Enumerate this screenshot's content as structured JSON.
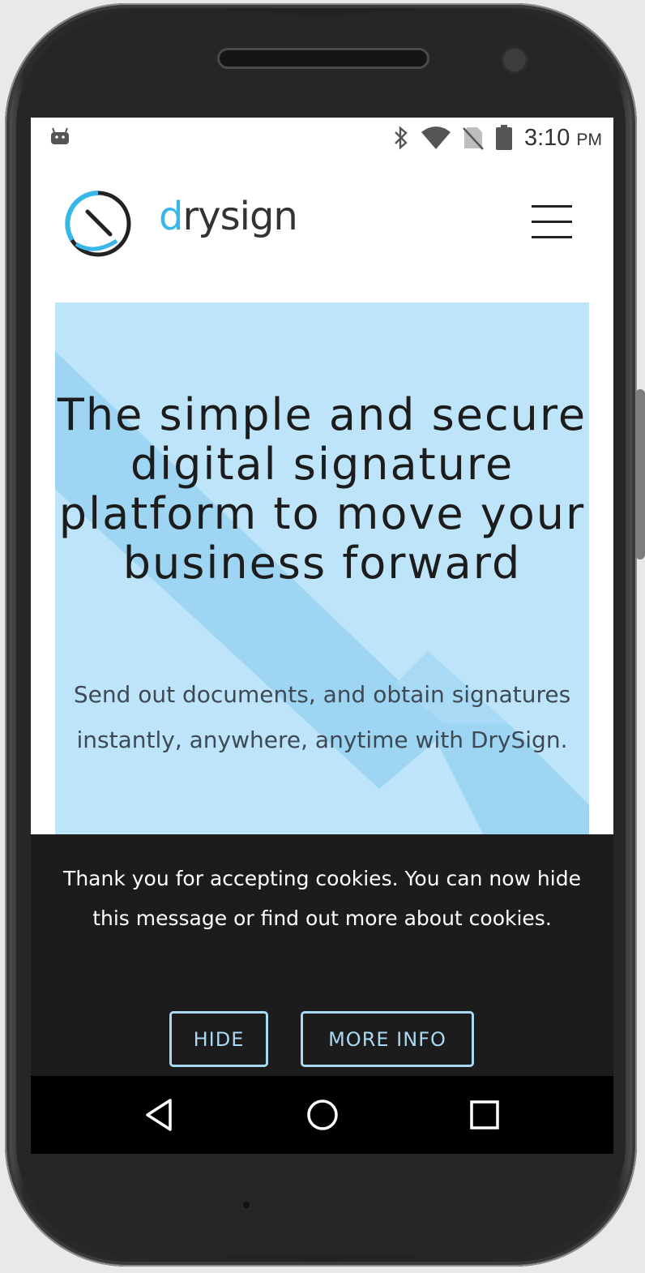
{
  "status_bar": {
    "time": "3:10",
    "ampm": "PM",
    "icons": [
      "android-debug-icon",
      "bluetooth-icon",
      "wifi-icon",
      "no-sim-icon",
      "battery-icon"
    ]
  },
  "header": {
    "logo_text_prefix": "d",
    "logo_text_rest": "rysign",
    "menu_icon": "hamburger-menu-icon"
  },
  "hero": {
    "title": "The simple and secure digital signature platform to move your business forward",
    "subtitle": "Send out documents, and obtain signatures instantly, anywhere, anytime with DrySign."
  },
  "cookie_banner": {
    "message": "Thank you for accepting cookies. You can now hide this message or find out more about cookies.",
    "hide_label": "HIDE",
    "more_info_label": "MORE INFO"
  },
  "nav_bar": {
    "icons": [
      "back-icon",
      "home-icon",
      "recents-icon"
    ]
  },
  "colors": {
    "brand_accent": "#38b6e8",
    "hero_background": "#bde4f8",
    "cookie_background": "#1c1c1d",
    "cookie_button_border": "#a9d8f2"
  }
}
